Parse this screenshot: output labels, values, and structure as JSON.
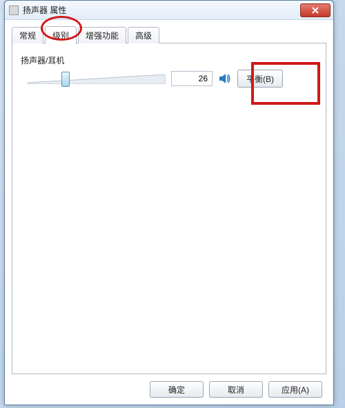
{
  "window": {
    "title": "扬声器 属性"
  },
  "tabs": {
    "items": [
      {
        "label": "常规"
      },
      {
        "label": "级别"
      },
      {
        "label": "增强功能"
      },
      {
        "label": "高级"
      }
    ],
    "active_index": 1
  },
  "levels": {
    "group_label": "扬声器/耳机",
    "value": "26",
    "slider_percent": 26,
    "balance_button": "平衡(B)"
  },
  "footer": {
    "ok": "确定",
    "cancel": "取消",
    "apply": "应用(A)"
  }
}
